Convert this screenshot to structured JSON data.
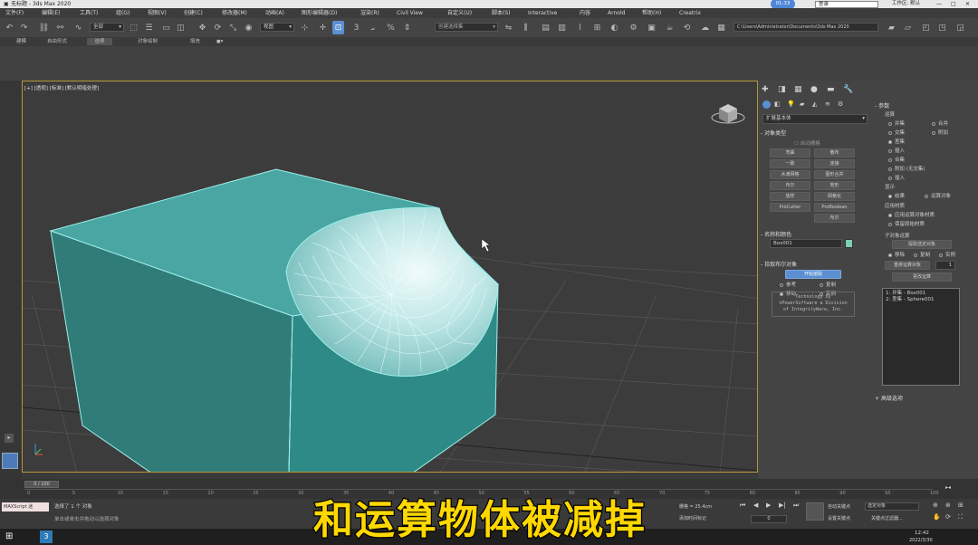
{
  "title": {
    "app": "无标题 - 3ds Max 2020",
    "badge": "01:33",
    "user": "登录",
    "workspace": "工作区: 默认"
  },
  "menu": [
    "文件(F)",
    "编辑(E)",
    "工具(T)",
    "组(G)",
    "视图(V)",
    "创建(C)",
    "修改器(M)",
    "动画(A)",
    "图形编辑器(D)",
    "渲染(R)",
    "Civil View",
    "自定义(U)",
    "脚本(S)",
    "Interactive",
    "内容",
    "Arnold",
    "帮助(H)",
    "Creatrix"
  ],
  "toolbar": {
    "filter": "全部",
    "refcoord": "视图",
    "selection_set": "创建选择集",
    "path": "C:\\Users\\Administrator\\Documents\\3ds Max 2020",
    "snap": "3",
    "angle_snap": "2"
  },
  "ribbon": [
    "建模",
    "自由形式",
    "选择",
    "对象绘制",
    "填充"
  ],
  "viewport": {
    "label": "[+] [透视] [标准] [默认明暗处理]"
  },
  "cmd": {
    "category": "扩展基本体",
    "object_type": {
      "title": "对象类型",
      "autogrid": "自动栅格",
      "buttons": [
        "弯曲",
        "散布",
        "一致",
        "连接",
        "水滴网格",
        "图形合并",
        "布尔",
        "地形",
        "放样",
        "网格化",
        "ProBoolean",
        "ProCutter",
        "布尔"
      ]
    },
    "name_color": {
      "title": "名称和颜色",
      "name": "Box001",
      "color": "#7ed0b0"
    },
    "pick": {
      "title": "拾取布尔对象",
      "button": "开始拾取",
      "options": [
        "参考",
        "复制",
        "移动",
        "实例"
      ],
      "credit": [
        "Technology by",
        "nPowerSoftware a Division",
        "of IntegrityWare, Inc."
      ]
    }
  },
  "params": {
    "title": "参数",
    "op_title": "运算",
    "ops": [
      "并集",
      "合并",
      "交集",
      "附加",
      "差集",
      "插入",
      "合集",
      "附加 (无交集)",
      "插入"
    ],
    "display_title": "显示",
    "display": [
      "结果",
      "运算对象"
    ],
    "material_title": "应用材质",
    "material": [
      "应用运算对象材质",
      "保留原始材质"
    ],
    "sub_title": "子对象运算",
    "sub_btn": "提取选定对象",
    "sub_opts": [
      "移除",
      "复制",
      "实例"
    ],
    "reorder": "重排运算对象",
    "reorder_val": "1",
    "change": "更改运算",
    "operands": [
      "1: 并集 - Box001",
      "2: 差集 - Sphere001"
    ],
    "advanced": "高级选项"
  },
  "timeline": {
    "frame": "0 / 100",
    "ticks": [
      "0",
      "5",
      "10",
      "15",
      "20",
      "25",
      "30",
      "35",
      "40",
      "45",
      "50",
      "55",
      "60",
      "65",
      "70",
      "75",
      "80",
      "85",
      "90",
      "95",
      "100"
    ]
  },
  "status": {
    "maxscript": "MAXScript 迷",
    "selected": "选择了 1 个 对象",
    "hint": "单击或单击并拖动以选择对象",
    "grid": "栅格 = 25.4cm",
    "addkey": "添加时间标记",
    "autokey": "自动关键点",
    "autokey_opt": "选定对象",
    "setkey": "设置关键点",
    "keyfilter": "关键点过滤器...",
    "frame_val": "0"
  },
  "taskbar": {
    "time": "12:42",
    "date": "2022/3/30"
  },
  "caption": "和运算物体被减掉"
}
